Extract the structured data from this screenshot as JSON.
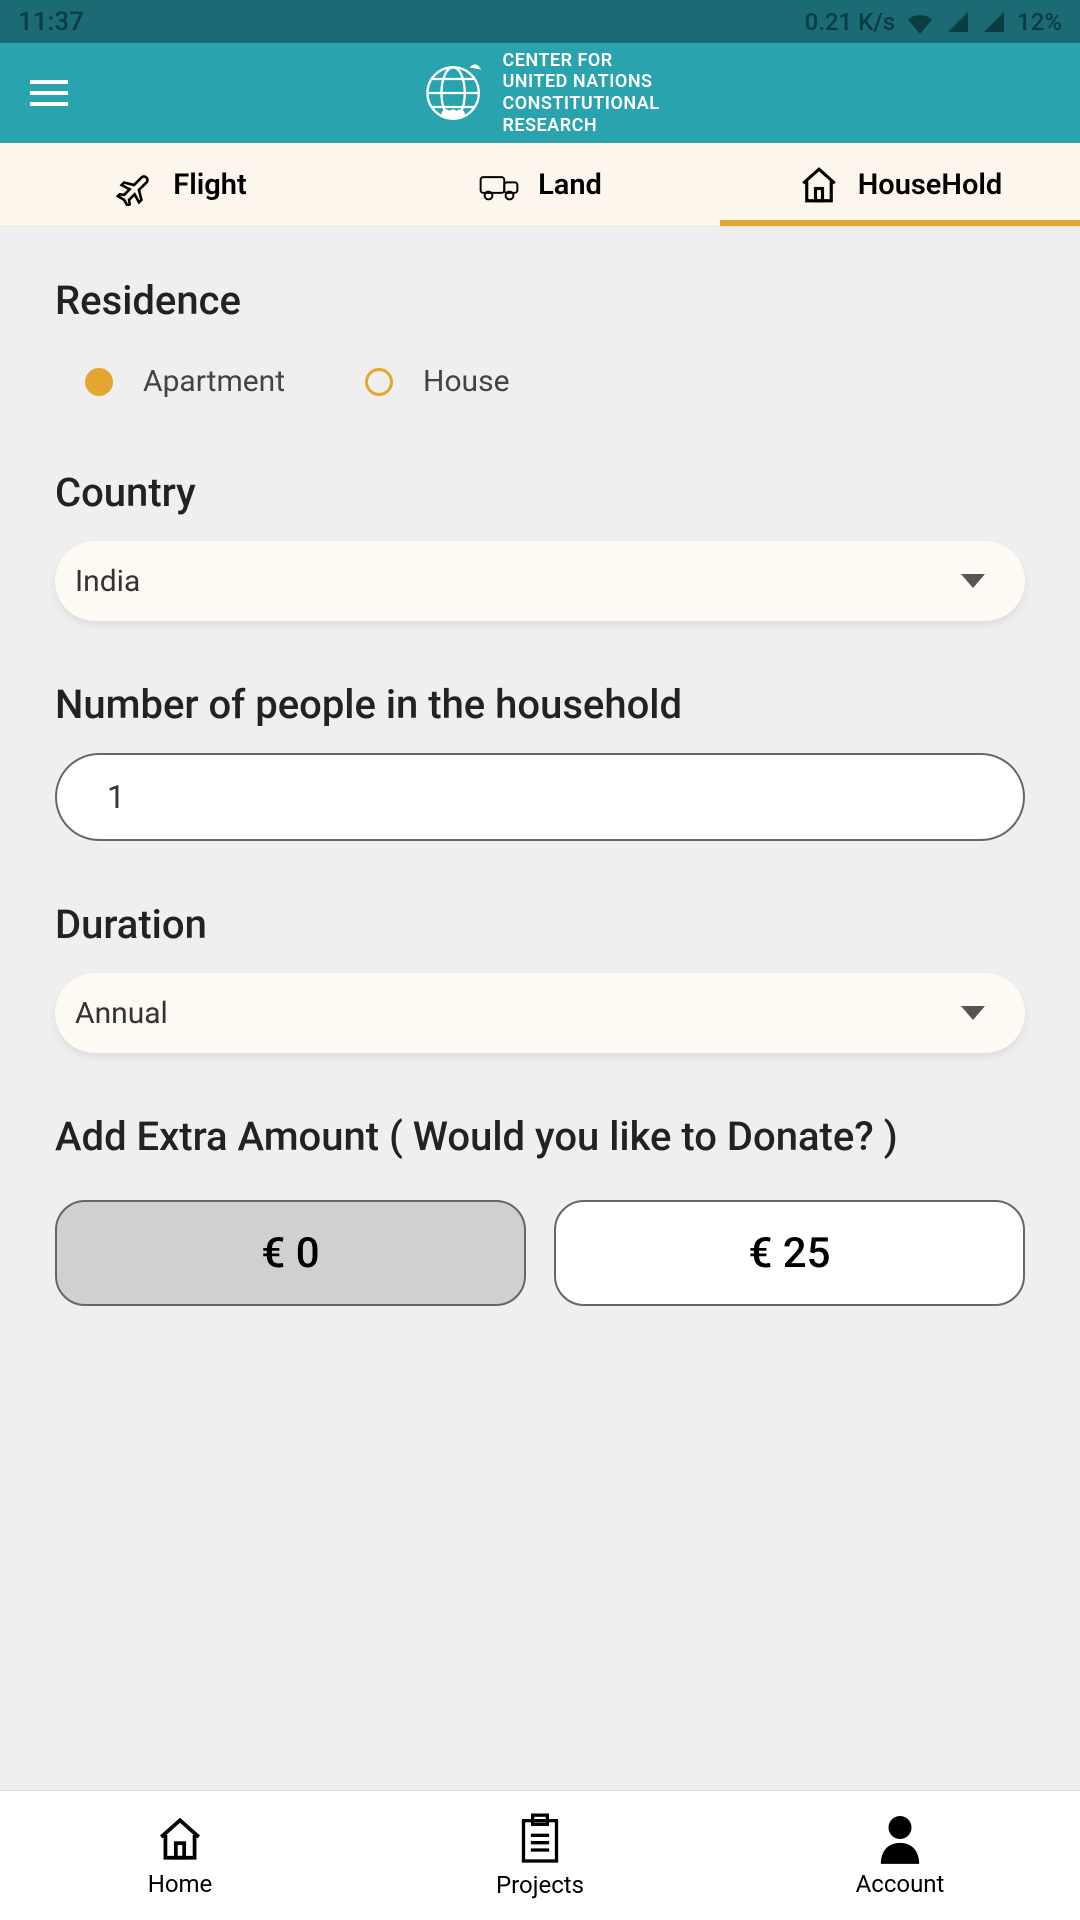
{
  "status_bar": {
    "time": "11:37",
    "network_speed": "0.21 K/s",
    "battery": "12%"
  },
  "header": {
    "logo_line1": "CENTER FOR",
    "logo_line2": "UNITED NATIONS",
    "logo_line3": "CONSTITUTIONAL",
    "logo_line4": "RESEARCH"
  },
  "tabs": {
    "flight": "Flight",
    "land": "Land",
    "household": "HouseHold"
  },
  "form": {
    "residence_title": "Residence",
    "residence_options": {
      "apartment": "Apartment",
      "house": "House"
    },
    "country_label": "Country",
    "country_value": "India",
    "people_label": "Number of people in the household",
    "people_value": "1",
    "duration_label": "Duration",
    "duration_value": "Annual",
    "extra_label": "Add Extra Amount ( Would you like to Donate? )",
    "amount_0": "€ 0",
    "amount_25": "€ 25"
  },
  "bottom_nav": {
    "home": "Home",
    "projects": "Projects",
    "account": "Account"
  }
}
